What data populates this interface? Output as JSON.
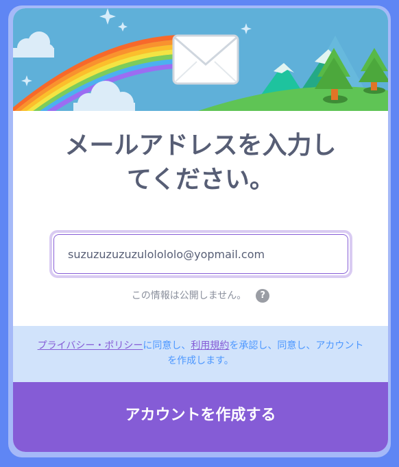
{
  "title": {
    "line1": "メールアドレスを入力し",
    "line2": "てください。"
  },
  "email": {
    "value": "suzuzuzuzuzulolololo@yopmail.com"
  },
  "privacy_note": "この情報は公開しません。",
  "help_glyph": "?",
  "terms": {
    "privacy_link": "プライバシー・ポリシー",
    "text_a": "に同意し、",
    "terms_link": "利用規約",
    "text_b": "を承認し、同意し、アカウントを作成します。"
  },
  "submit_label": "アカウントを作成する",
  "colors": {
    "background": "#5f86f4",
    "accent": "#855cd6",
    "terms_bg": "#d1e3fb",
    "text": "#575e75"
  }
}
